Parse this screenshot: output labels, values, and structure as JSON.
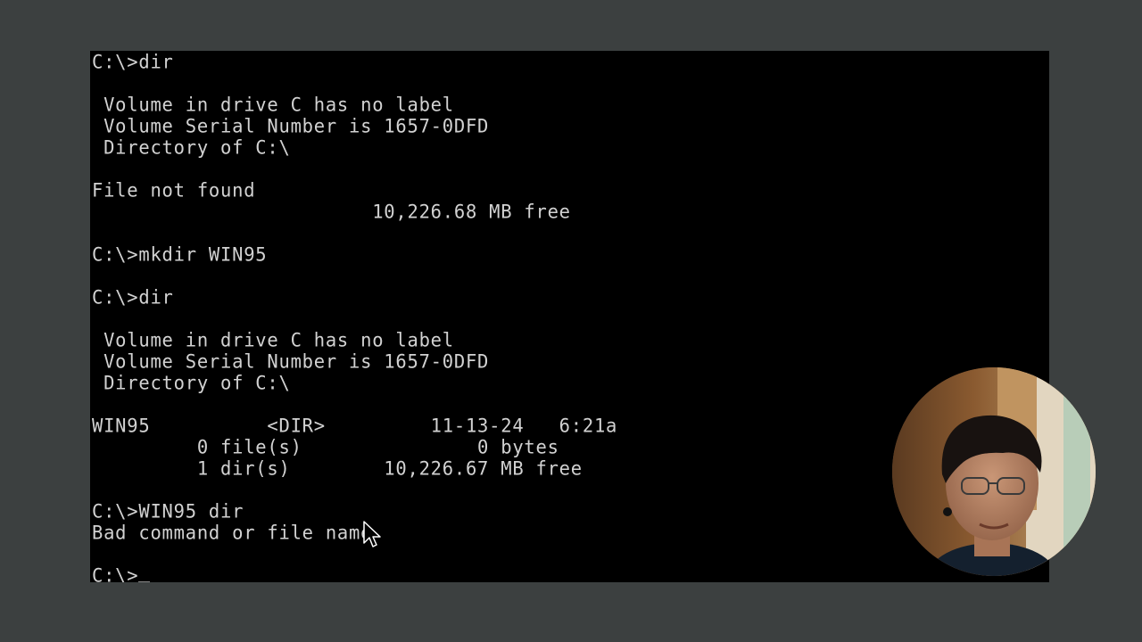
{
  "terminal": {
    "lines": [
      "C:\\>dir",
      "",
      " Volume in drive C has no label",
      " Volume Serial Number is 1657-0DFD",
      " Directory of C:\\",
      "",
      "File not found",
      "                        10,226.68 MB free",
      "",
      "C:\\>mkdir WIN95",
      "",
      "C:\\>dir",
      "",
      " Volume in drive C has no label",
      " Volume Serial Number is 1657-0DFD",
      " Directory of C:\\",
      "",
      "WIN95          <DIR>         11-13-24   6:21a",
      "         0 file(s)               0 bytes",
      "         1 dir(s)        10,226.67 MB free",
      "",
      "C:\\>WIN95 dir",
      "Bad command or file name",
      ""
    ],
    "prompt": "C:\\>"
  },
  "colors": {
    "background": "#3c4040",
    "screen": "#000000",
    "text": "#d2d2d2"
  },
  "icons": {
    "pointer": "mouse-pointer-icon"
  }
}
